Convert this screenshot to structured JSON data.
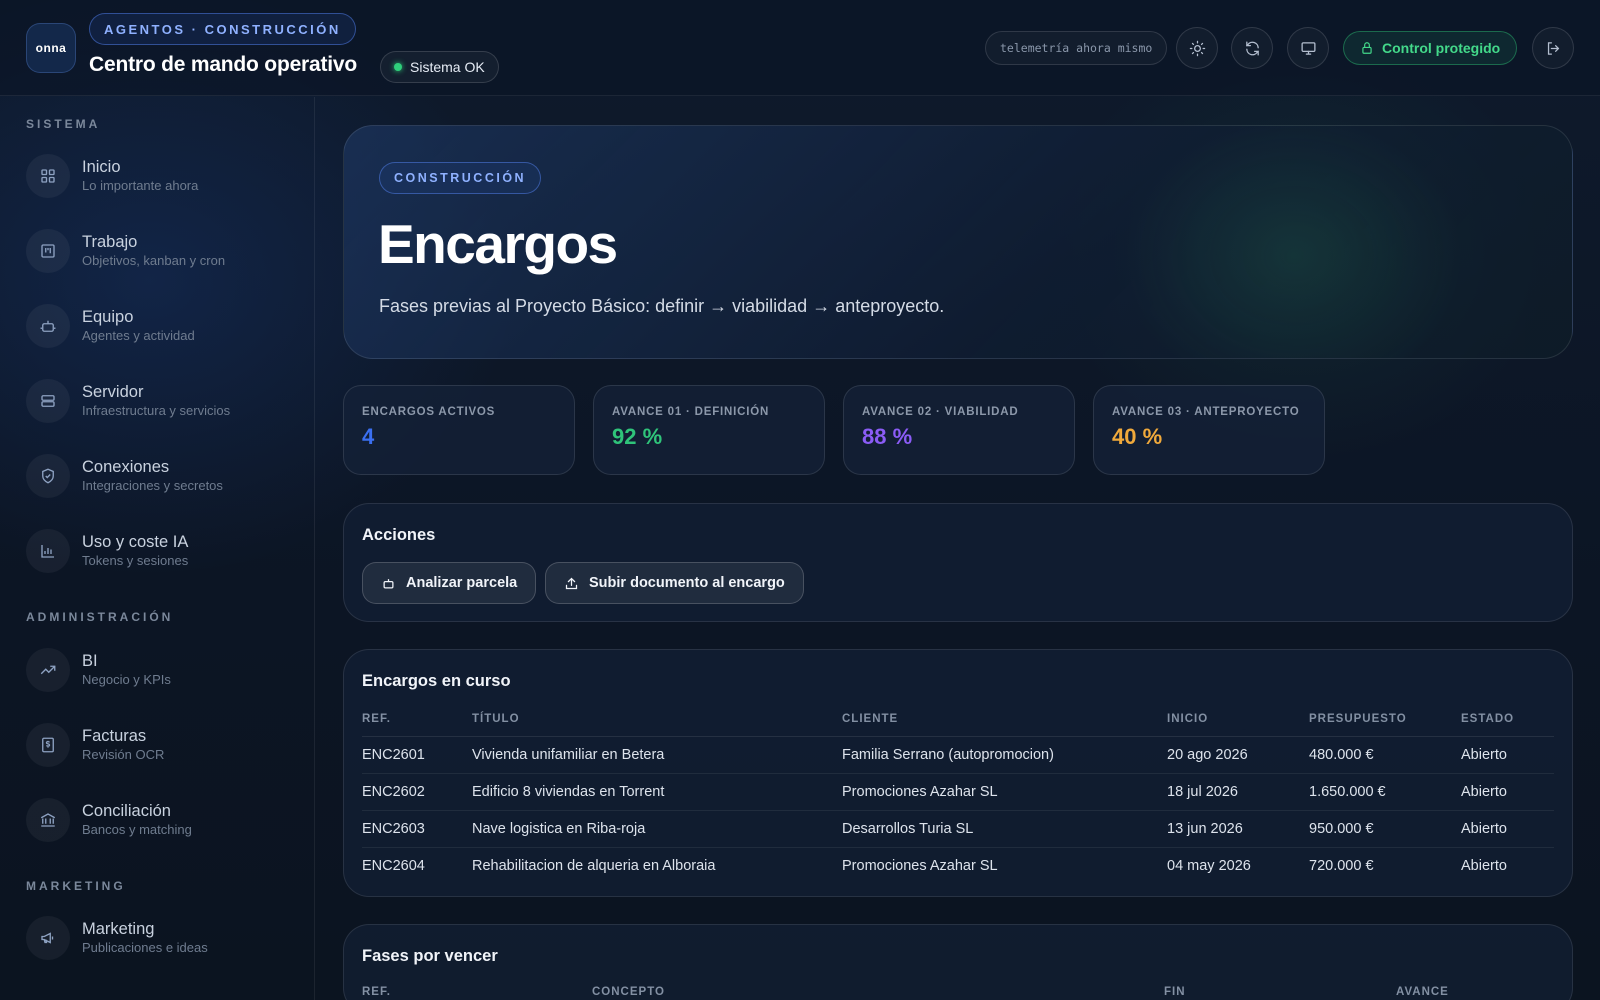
{
  "header": {
    "logo_text": "onna",
    "context": "AGENTOS · CONSTRUCCIÓN",
    "title": "Centro de mando operativo",
    "status": "Sistema OK",
    "telemetry": "telemetría ahora mismo",
    "protect_label": "Control protegido",
    "status_color": "#2fd07b"
  },
  "sidebar": {
    "sections": [
      {
        "label": "SISTEMA",
        "items": [
          {
            "title": "Inicio",
            "subtitle": "Lo importante ahora",
            "icon": "dashboard-grid-icon"
          },
          {
            "title": "Trabajo",
            "subtitle": "Objetivos, kanban y cron",
            "icon": "kanban-icon"
          },
          {
            "title": "Equipo",
            "subtitle": "Agentes y actividad",
            "icon": "robot-icon"
          },
          {
            "title": "Servidor",
            "subtitle": "Infraestructura y servicios",
            "icon": "server-icon"
          },
          {
            "title": "Conexiones",
            "subtitle": "Integraciones y secretos",
            "icon": "shield-check-icon"
          },
          {
            "title": "Uso y coste IA",
            "subtitle": "Tokens y sesiones",
            "icon": "bar-chart-icon"
          }
        ]
      },
      {
        "label": "ADMINISTRACIÓN",
        "items": [
          {
            "title": "BI",
            "subtitle": "Negocio y KPIs",
            "icon": "trend-up-icon"
          },
          {
            "title": "Facturas",
            "subtitle": "Revisión OCR",
            "icon": "invoice-dollar-icon"
          },
          {
            "title": "Conciliación",
            "subtitle": "Bancos y matching",
            "icon": "bank-icon"
          }
        ]
      },
      {
        "label": "MARKETING",
        "items": [
          {
            "title": "Marketing",
            "subtitle": "Publicaciones e ideas",
            "icon": "megaphone-icon"
          }
        ]
      }
    ]
  },
  "hero": {
    "tag": "CONSTRUCCIÓN",
    "title": "Encargos",
    "description": "Fases previas al Proyecto Básico: definir → viabilidad → anteproyecto."
  },
  "kpis": [
    {
      "label": "ENCARGOS ACTIVOS",
      "value": "4",
      "color": "#3b6ff0"
    },
    {
      "label": "AVANCE 01 · DEFINICIÓN",
      "value": "92 %",
      "color": "#2fc47a"
    },
    {
      "label": "AVANCE 02 · VIABILIDAD",
      "value": "88 %",
      "color": "#8b5cf6"
    },
    {
      "label": "AVANCE 03 · ANTEPROYECTO",
      "value": "40 %",
      "color": "#f0a93b"
    }
  ],
  "actions": {
    "title": "Acciones",
    "buttons": [
      {
        "label": "Analizar parcela",
        "icon": "robot-icon"
      },
      {
        "label": "Subir documento al encargo",
        "icon": "upload-icon"
      }
    ]
  },
  "encargos_table": {
    "title": "Encargos en curso",
    "columns": [
      "REF.",
      "TÍTULO",
      "CLIENTE",
      "INICIO",
      "PRESUPUESTO",
      "ESTADO"
    ],
    "rows": [
      [
        "ENC2601",
        "Vivienda unifamiliar en Betera",
        "Familia Serrano (autopromocion)",
        "20 ago 2026",
        "480.000 €",
        "Abierto"
      ],
      [
        "ENC2602",
        "Edificio 8 viviendas en Torrent",
        "Promociones Azahar SL",
        "18 jul 2026",
        "1.650.000 €",
        "Abierto"
      ],
      [
        "ENC2603",
        "Nave logistica en Riba-roja",
        "Desarrollos Turia SL",
        "13 jun 2026",
        "950.000 €",
        "Abierto"
      ],
      [
        "ENC2604",
        "Rehabilitacion de alqueria en Alboraia",
        "Promociones Azahar SL",
        "04 may 2026",
        "720.000 €",
        "Abierto"
      ]
    ]
  },
  "fases_table": {
    "title": "Fases por vencer",
    "columns": [
      "REF.",
      "CONCEPTO",
      "FIN",
      "AVANCE"
    ]
  }
}
